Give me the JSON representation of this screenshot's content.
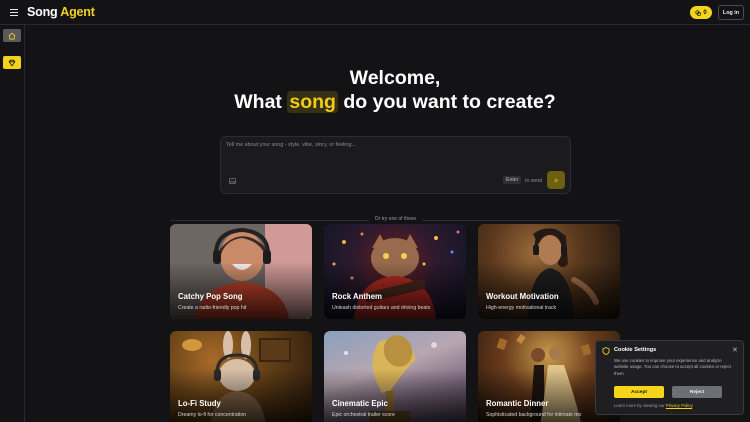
{
  "header": {
    "logo_part1": "Song",
    "logo_part2": "Agent",
    "credits_count": "0",
    "login_label": "Log in"
  },
  "sidebar": {
    "items": [
      {
        "icon": "home-icon"
      },
      {
        "icon": "gem-icon"
      }
    ]
  },
  "hero": {
    "line1": "Welcome,",
    "line2_before": "What ",
    "line2_highlight": "song",
    "line2_after": " do you want to create?"
  },
  "prompt": {
    "placeholder": "Tell me about your song - style, vibe, story, or feeling...",
    "enter_key": "Enter",
    "send_hint": "to send"
  },
  "divider_text": "Or try one of these",
  "cards": [
    {
      "title": "Catchy Pop Song",
      "description": "Create a radio-friendly pop hit"
    },
    {
      "title": "Rock Anthem",
      "description": "Unleash distorted guitars and driving beats"
    },
    {
      "title": "Workout Motivation",
      "description": "High-energy motivational track"
    },
    {
      "title": "Lo-Fi Study",
      "description": "Dreamy lo-fi for concentration"
    },
    {
      "title": "Cinematic Epic",
      "description": "Epic orchestral trailer score"
    },
    {
      "title": "Romantic Dinner",
      "description": "Sophisticated background for intimate mo"
    }
  ],
  "cookie": {
    "title": "Cookie Settings",
    "body": "We use cookies to improve your experience and analyze website usage. You can choose to accept all cookies or reject them.",
    "accept_label": "Accept",
    "reject_label": "Reject",
    "footer_text": "Learn more by viewing our",
    "footer_link": "Privacy Policy",
    "footer_end": "."
  },
  "colors": {
    "accent": "#f2d21c",
    "background": "#131315"
  }
}
